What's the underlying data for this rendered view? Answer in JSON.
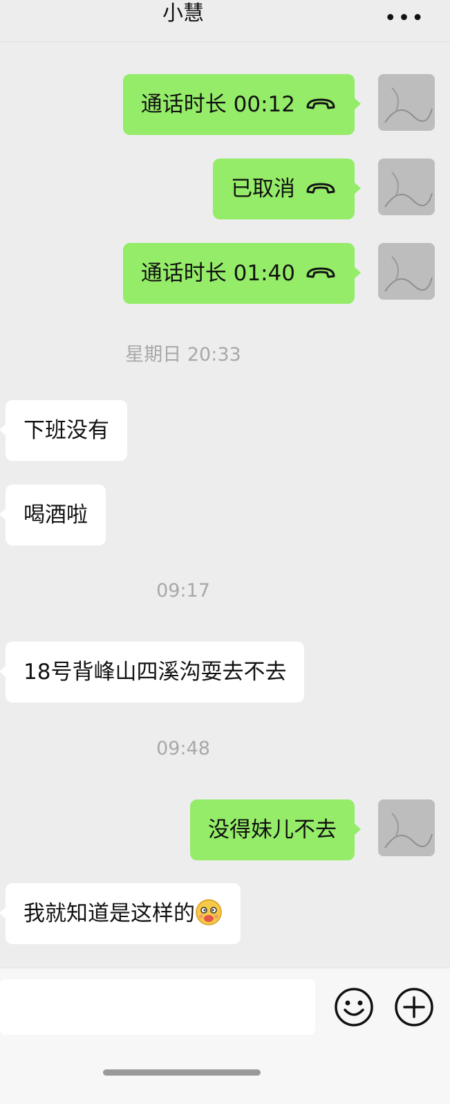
{
  "header": {
    "title": "小慧",
    "more_icon": "more-dots-icon"
  },
  "colors": {
    "outgoing_bubble": "#95ec69",
    "incoming_bubble": "#ffffff",
    "background": "#ededed"
  },
  "messages": [
    {
      "direction": "out",
      "type": "call",
      "text": "通话时长 00:12",
      "icon": "phone-hangup-icon"
    },
    {
      "direction": "out",
      "type": "call",
      "text": "已取消",
      "icon": "phone-hangup-icon"
    },
    {
      "direction": "out",
      "type": "call",
      "text": "通话时长 01:40",
      "icon": "phone-hangup-icon"
    },
    {
      "type": "timestamp",
      "text": "星期日 20:33"
    },
    {
      "direction": "in",
      "type": "text",
      "text": "下班没有"
    },
    {
      "direction": "in",
      "type": "text",
      "text": "喝酒啦"
    },
    {
      "type": "timestamp",
      "text": "09:17"
    },
    {
      "direction": "in",
      "type": "text",
      "text": "18号背峰山四溪沟耍去不去"
    },
    {
      "type": "timestamp",
      "text": "09:48"
    },
    {
      "direction": "out",
      "type": "text",
      "text": "没得妹儿不去"
    },
    {
      "direction": "in",
      "type": "text",
      "text": "我就知道是这样的",
      "emoji": "blushing-face-emoji"
    }
  ],
  "input_bar": {
    "emoji_button": "smiley-icon",
    "add_button": "plus-circle-icon"
  }
}
